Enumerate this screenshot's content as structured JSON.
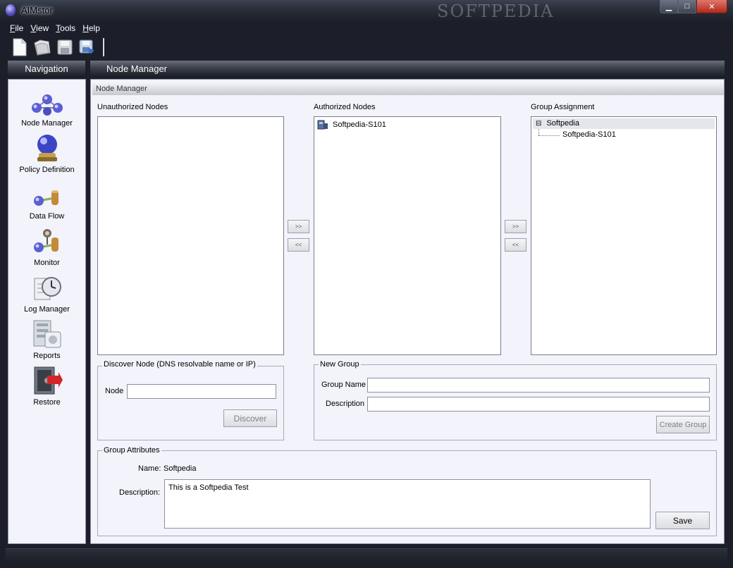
{
  "window": {
    "title": "AIMstor",
    "watermark": "SOFTPEDIA",
    "minimize": "▁",
    "maximize": "□",
    "close": "✕"
  },
  "menu": [
    {
      "underline": "F",
      "rest": "ile"
    },
    {
      "underline": "V",
      "rest": "iew"
    },
    {
      "underline": "T",
      "rest": "ools"
    },
    {
      "underline": "H",
      "rest": "elp"
    }
  ],
  "toolbar": {
    "icons": [
      "new-document-icon",
      "open-folder-icon",
      "save-icon",
      "save-as-icon"
    ]
  },
  "navigation": {
    "header": "Navigation",
    "items": [
      {
        "label": "Node Manager",
        "icon": "node-manager-icon"
      },
      {
        "label": "Policy Definition",
        "icon": "policy-definition-icon"
      },
      {
        "label": "Data Flow",
        "icon": "data-flow-icon"
      },
      {
        "label": "Monitor",
        "icon": "monitor-icon"
      },
      {
        "label": "Log Manager",
        "icon": "log-manager-icon"
      },
      {
        "label": "Reports",
        "icon": "reports-icon"
      },
      {
        "label": "Restore",
        "icon": "restore-icon"
      }
    ]
  },
  "main": {
    "header": "Node Manager",
    "subheader": "Node Manager",
    "unauthorized": {
      "label": "Unauthorized Nodes",
      "items": []
    },
    "authorized": {
      "label": "Authorized Nodes",
      "items": [
        "Softpedia-S101"
      ]
    },
    "move_right_label": ">>",
    "move_left_label": "<<",
    "group_assignment": {
      "label": "Group Assignment",
      "group": "Softpedia",
      "expander": "⊟",
      "child": "Softpedia-S101"
    },
    "discover": {
      "title": "Discover Node (DNS  resolvable name or IP)",
      "node_label": "Node",
      "node_value": "",
      "button": "Discover"
    },
    "new_group": {
      "title": "New Group",
      "name_label": "Group Name",
      "name_value": "",
      "description_label": "Description",
      "description_value": "",
      "button": "Create Group"
    },
    "group_attributes": {
      "title": "Group Attributes",
      "name_label": "Name:",
      "name_value": "Softpedia",
      "description_label": "Description:",
      "description_value": "This is a Softpedia Test",
      "save_button": "Save"
    }
  }
}
